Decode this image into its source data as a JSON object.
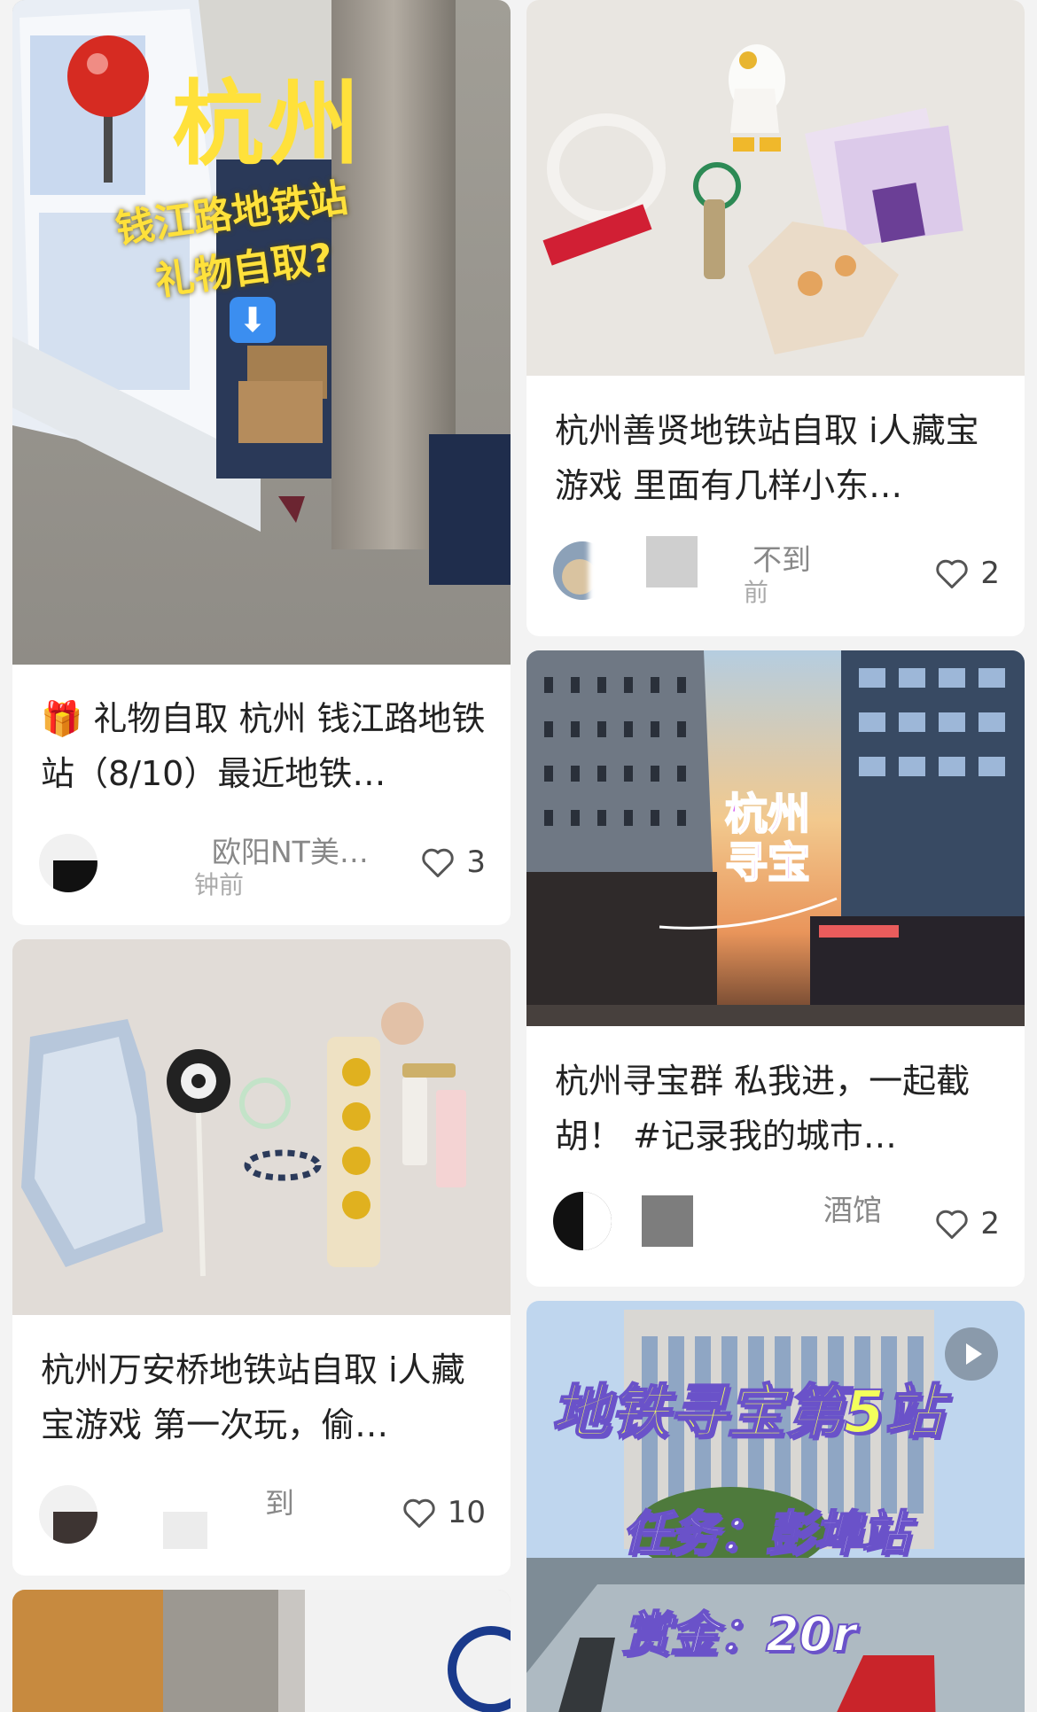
{
  "feed": {
    "cards": [
      {
        "title": "🎁 礼物自取 杭州 钱江路地铁站（8/10）最近地铁…",
        "cover_text": [
          "杭州",
          "钱江路地铁站",
          "礼物自取?"
        ],
        "author_fragment": "欧阳NT美…",
        "time_fragment": "钟前",
        "likes": "3"
      },
      {
        "title": "杭州万安桥地铁站自取 i人藏宝游戏 第一次玩，偷…",
        "author_fragment": "到",
        "likes": "10"
      },
      {
        "title": "杭州善贤地铁站自取 i人藏宝游戏 里面有几样小东…",
        "author_fragment": "不到",
        "time_fragment": "前",
        "likes": "2"
      },
      {
        "title": "杭州寻宝群 私我进，一起截胡！ #记录我的城市…",
        "cover_text": [
          "杭州",
          "寻宝"
        ],
        "author_fragment": "酒馆",
        "likes": "2"
      },
      {
        "cover_text": [
          "地铁寻宝第5站",
          "任务：彭埠站",
          "赏金：20r"
        ]
      }
    ]
  },
  "icons": {
    "like": "heart-outline-icon",
    "play": "play-icon",
    "gift": "gift-emoji-icon",
    "arrow": "arrow-down-icon"
  },
  "colors": {
    "background": "#f3f3f3",
    "card": "#ffffff",
    "title": "#222222",
    "meta": "#888888",
    "cover_yellow": "#ffe13b",
    "cover_purple": "#d36cf0"
  }
}
